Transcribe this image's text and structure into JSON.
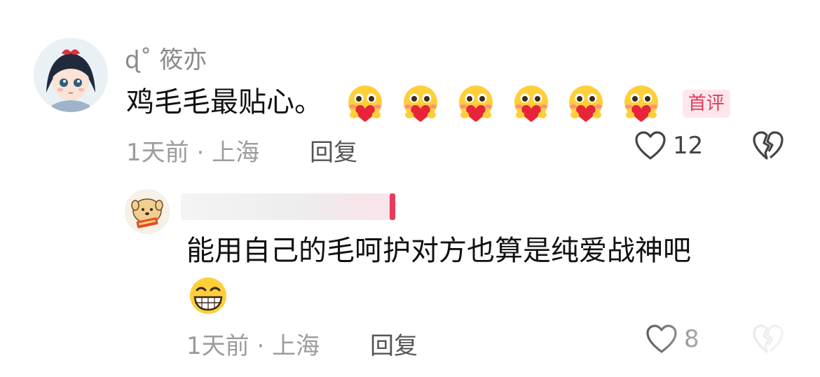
{
  "comments": [
    {
      "username": "ɖ˚ 筱亦",
      "text": "鸡毛毛最贴心。",
      "emoji_icons": [
        "heart-hug-emoji",
        "heart-hug-emoji",
        "heart-hug-emoji",
        "heart-hug-emoji",
        "heart-hug-emoji",
        "heart-hug-emoji"
      ],
      "badge": "首评",
      "time": "1天前",
      "separator": "·",
      "location": "上海",
      "reply_label": "回复",
      "like_count": "12",
      "icons": {
        "like": "heart-outline-icon",
        "dislike": "broken-heart-icon"
      },
      "colors": {
        "badge_bg": "#fde7ec",
        "badge_text": "#e5395c"
      }
    },
    {
      "username": "",
      "text_line1": "能用自己的毛呵护对方也算是纯爱战神吧",
      "emoji_icons": [
        "grin-emoji"
      ],
      "time": "1天前",
      "separator": "·",
      "location": "上海",
      "reply_label": "回复",
      "like_count": "8",
      "icons": {
        "like": "heart-outline-icon",
        "dislike": "broken-heart-icon"
      }
    }
  ]
}
